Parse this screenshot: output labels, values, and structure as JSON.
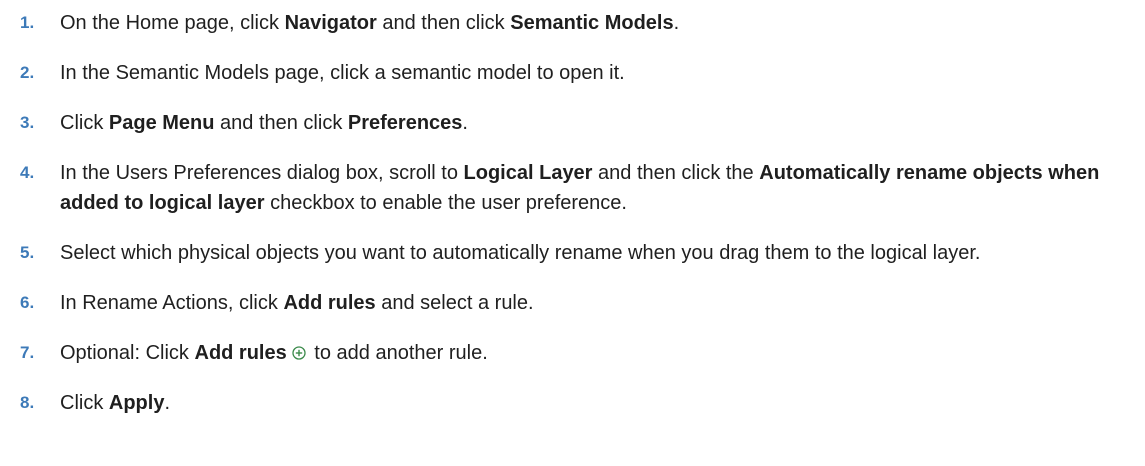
{
  "steps": [
    {
      "number": "1.",
      "parts": [
        "On the Home page, click ",
        "Navigator",
        " and then click ",
        "Semantic Models",
        "."
      ]
    },
    {
      "number": "2.",
      "parts": [
        "In the Semantic Models page, click a semantic model to open it."
      ]
    },
    {
      "number": "3.",
      "parts": [
        "Click ",
        "Page Menu",
        " and then click ",
        "Preferences",
        "."
      ]
    },
    {
      "number": "4.",
      "parts": [
        "In the Users Preferences dialog box, scroll to ",
        "Logical Layer",
        " and then click the ",
        "Automatically rename objects when added to logical layer",
        " checkbox to enable the user preference."
      ]
    },
    {
      "number": "5.",
      "parts": [
        "Select which physical objects you want to automatically rename when you drag them to the logical layer."
      ]
    },
    {
      "number": "6.",
      "parts": [
        "In Rename Actions, click ",
        "Add rules",
        " and select a rule."
      ]
    },
    {
      "number": "7.",
      "parts": [
        "Optional: Click ",
        "Add rules",
        " to add another rule."
      ],
      "icon": "add-circle-icon"
    },
    {
      "number": "8.",
      "parts": [
        "Click ",
        "Apply",
        "."
      ]
    }
  ],
  "colors": {
    "step_number": "#3d7ab8",
    "text": "#1f1f1f",
    "icon": "#3a8a4a"
  }
}
